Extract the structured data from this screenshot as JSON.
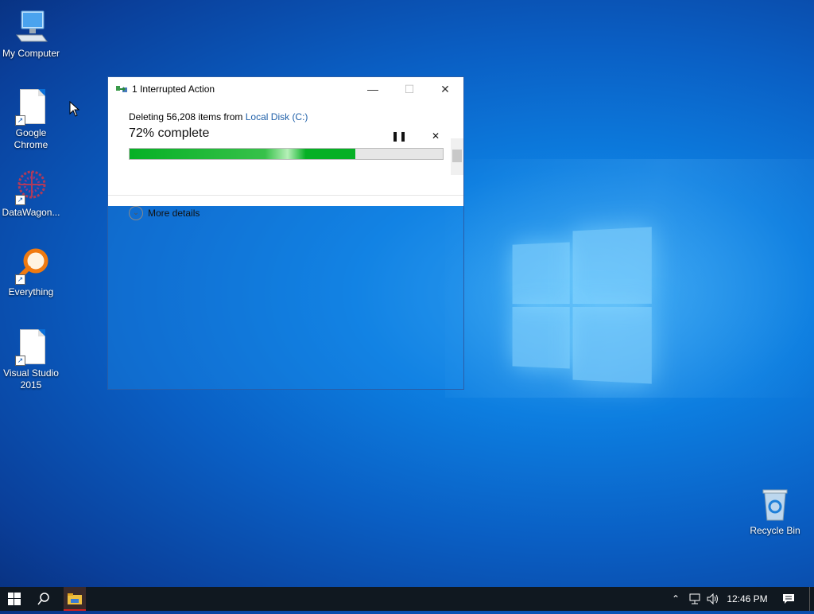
{
  "desktop": {
    "icons": [
      {
        "label": "My Computer",
        "icon": "computer-icon"
      },
      {
        "label": "Google Chrome",
        "icon": "document-icon",
        "shortcut": true
      },
      {
        "label": "DataWagon...",
        "icon": "datawagon-icon",
        "shortcut": true
      },
      {
        "label": "Everything",
        "icon": "magnifier-icon",
        "shortcut": true
      },
      {
        "label": "Visual Studio 2015",
        "icon": "document-icon",
        "shortcut": true
      }
    ],
    "recycle_bin": {
      "label": "Recycle Bin",
      "icon": "recycle-bin-icon"
    },
    "shortcut_glyph": "↗"
  },
  "dialog": {
    "title": "1 Interrupted Action",
    "minimize_glyph": "—",
    "maximize_glyph": "☐",
    "close_glyph": "✕",
    "status_prefix": "Deleting 56,208 items from ",
    "source_link": "Local Disk (C:)",
    "percent_text": "72% complete",
    "progress": 0.72,
    "pause_glyph": "❚❚",
    "cancel_glyph": "✕",
    "more_details": "More details",
    "chevron_glyph": "⌄"
  },
  "taskbar": {
    "start_glyph": "⊞",
    "search_glyph": "⚲",
    "tray_up_glyph": "⌃",
    "network_glyph": "▭",
    "volume_glyph": "🕪",
    "time": "12:46 PM",
    "notification_glyph": "▤"
  },
  "colors": {
    "progress_green": "#06b025",
    "link_blue": "#1e5fa8",
    "taskbar": "#101820"
  }
}
